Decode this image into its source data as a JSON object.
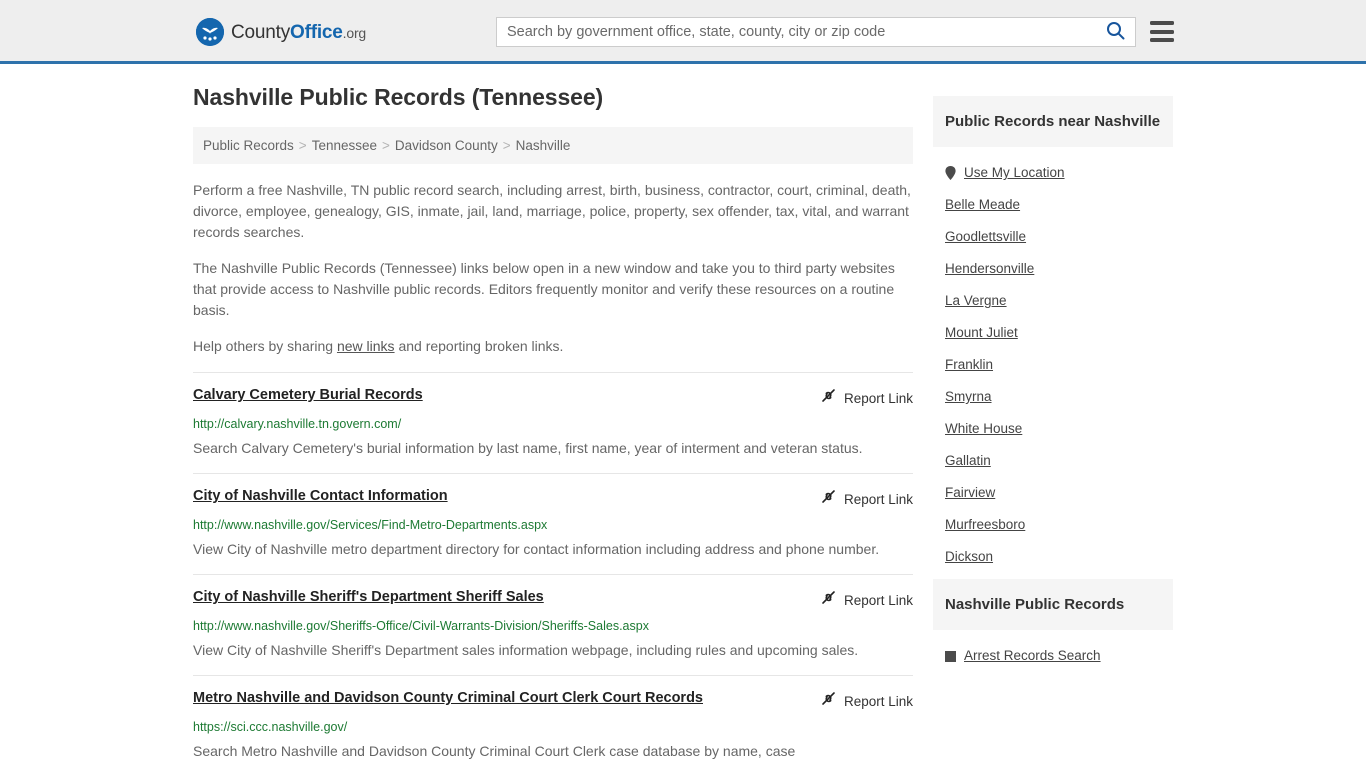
{
  "header": {
    "logo": {
      "part1": "County",
      "part2": "Office",
      "suffix": ".org",
      "icon": "eagle-seal-logo"
    },
    "search": {
      "placeholder": "Search by government office, state, county, city or zip code",
      "value": "",
      "button_icon": "search-icon"
    },
    "menu_icon": "hamburger-menu-icon",
    "accent_color": "#2e72ab"
  },
  "main": {
    "page_title": "Nashville Public Records (Tennessee)",
    "breadcrumb": {
      "separator": ">",
      "items": [
        {
          "label": "Public Records"
        },
        {
          "label": "Tennessee"
        },
        {
          "label": "Davidson County"
        },
        {
          "label": "Nashville"
        }
      ]
    },
    "intro": {
      "paragraph1": "Perform a free Nashville, TN public record search, including arrest, birth, business, contractor, court, criminal, death, divorce, employee, genealogy, GIS, inmate, jail, land, marriage, police, property, sex offender, tax, vital, and warrant records searches.",
      "paragraph2": "The Nashville Public Records (Tennessee) links below open in a new window and take you to third party websites that provide access to Nashville public records. Editors frequently monitor and verify these resources on a routine basis.",
      "paragraph3_pre": "Help others by sharing ",
      "paragraph3_link": "new links",
      "paragraph3_post": " and reporting broken links."
    },
    "report_link_label": "Report Link",
    "report_link_icon": "broken-link-icon",
    "results": [
      {
        "title": "Calvary Cemetery Burial Records",
        "url": "http://calvary.nashville.tn.govern.com/",
        "description": "Search Calvary Cemetery's burial information by last name, first name, year of interment and veteran status."
      },
      {
        "title": "City of Nashville Contact Information",
        "url": "http://www.nashville.gov/Services/Find-Metro-Departments.aspx",
        "description": "View City of Nashville metro department directory for contact information including address and phone number."
      },
      {
        "title": "City of Nashville Sheriff's Department Sheriff Sales",
        "url": "http://www.nashville.gov/Sheriffs-Office/Civil-Warrants-Division/Sheriffs-Sales.aspx",
        "description": "View City of Nashville Sheriff's Department sales information webpage, including rules and upcoming sales."
      },
      {
        "title": "Metro Nashville and Davidson County Criminal Court Clerk Court Records",
        "url": "https://sci.ccc.nashville.gov/",
        "description": "Search Metro Nashville and Davidson County Criminal Court Clerk case database by name, case"
      }
    ]
  },
  "sidebar": {
    "nearby": {
      "heading": "Public Records near Nashville",
      "use_my_location": {
        "label": "Use My Location",
        "icon": "map-pin-icon"
      },
      "cities": [
        {
          "label": "Belle Meade"
        },
        {
          "label": "Goodlettsville"
        },
        {
          "label": "Hendersonville"
        },
        {
          "label": "La Vergne"
        },
        {
          "label": "Mount Juliet"
        },
        {
          "label": "Franklin"
        },
        {
          "label": "Smyrna"
        },
        {
          "label": "White House"
        },
        {
          "label": "Gallatin"
        },
        {
          "label": "Fairview"
        },
        {
          "label": "Murfreesboro"
        },
        {
          "label": "Dickson"
        }
      ]
    },
    "records": {
      "heading": "Nashville Public Records",
      "items": [
        {
          "label": "Arrest Records Search",
          "icon": "square-bullet-icon"
        }
      ]
    }
  }
}
